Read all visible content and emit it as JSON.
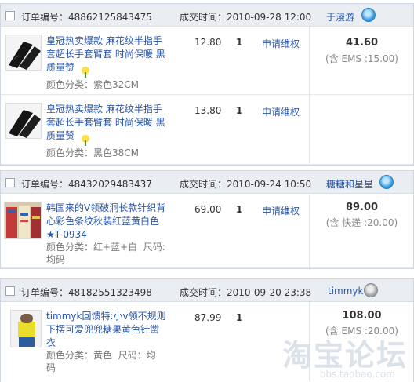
{
  "labels": {
    "order_no": "订单编号：",
    "deal_time": "成交时间：",
    "service": "申请维权",
    "color_prefix": "颜色分类："
  },
  "orders": [
    {
      "id": "48862125843475",
      "time": "2010-09-28 12:00",
      "seller": "于漫游",
      "total": "41.60",
      "shipping": "(含 EMS :15.00)",
      "items": [
        {
          "title": "皇冠热卖爆款 麻花纹半指手套超长手套臂套 时尚保暖 黑质量赞",
          "attr": "颜色分类：紫色32CM",
          "price": "12.80",
          "qty": "1"
        },
        {
          "title": "皇冠热卖爆款 麻花纹半指手套超长手套臂套 时尚保暖 黑质量赞",
          "attr": "颜色分类：黑色38CM",
          "price": "13.80",
          "qty": "1"
        }
      ]
    },
    {
      "id": "48432029483437",
      "time": "2010-09-24 10:50",
      "seller": "糖糖和星星",
      "total": "89.00",
      "shipping": "(含 快递 :20.00)",
      "items": [
        {
          "title": "韩国来的V领破洞长款针织背心彩色条纹秋装红蓝黄白色★T-0934",
          "attr1": "颜色分类：红+蓝+白  尺码:",
          "attr2": "均码",
          "price": "69.00",
          "qty": "1"
        }
      ]
    },
    {
      "id": "48182551323498",
      "time": "2010-09-20 23:38",
      "seller": "timmyk",
      "total": "108.00",
      "shipping": "(含 EMS :20.00)",
      "items": [
        {
          "title": "timmyk回馈特:小v领不规则下摆可爱兜兜糖果黄色针凿衣",
          "attr1": "颜色分类：黄色  尺码：均",
          "attr2": "码",
          "price": "87.99",
          "qty": "1"
        }
      ]
    }
  ],
  "watermark": {
    "main": "淘宝论坛",
    "sub": "bbs.taobao.com"
  }
}
